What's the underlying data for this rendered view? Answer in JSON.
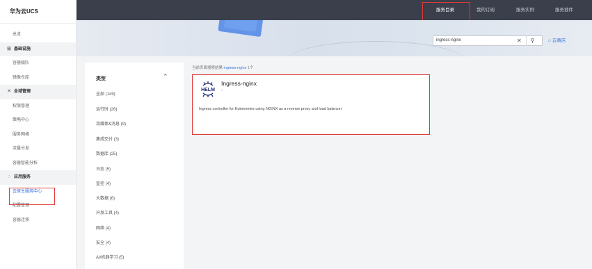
{
  "sidebar": {
    "brand": "华为云UCS",
    "overview": "总览",
    "group_infra": "基础设施",
    "infra_items": [
      "容器舰队",
      "镜像仓库"
    ],
    "group_global": "全域管理",
    "global_items": [
      "权限管理",
      "策略中心",
      "服务网格",
      "流量分发",
      "容器智能分析"
    ],
    "group_app": "应用服务",
    "app_items": [
      "云原生服务中心",
      "配置管理",
      "容器迁移"
    ]
  },
  "topnav": {
    "items": [
      "服务目录",
      "我的订阅",
      "服务实例",
      "服务插件"
    ],
    "selected": "服务目录"
  },
  "search": {
    "value": "ingress-nginx",
    "store_label": "云商店"
  },
  "filter": {
    "title": "类型",
    "items": [
      "全部 (149)",
      "运行时 (26)",
      "流媒体&消息 (9)",
      "集成交付 (3)",
      "数据库 (25)",
      "日志 (5)",
      "监控 (4)",
      "大数据 (6)",
      "开发工具 (4)",
      "网络 (4)",
      "安全 (4)",
      "AI/机器学习 (5)"
    ]
  },
  "results": {
    "prefix": "当前页面搜索结果",
    "keyword": "ingress-nginx",
    "count": "1个"
  },
  "card": {
    "logo_text": "HELM",
    "title": "Ingress-nginx",
    "version": "-",
    "description": "Ingress controller for Kubernetes using NGINX as a reverse proxy and load balancer"
  },
  "colors": {
    "accent": "#2f6fe0",
    "highlight_box": "#e03a3a",
    "topbar_bg": "#3a3f4b",
    "helm_blue": "#1e2a78"
  }
}
